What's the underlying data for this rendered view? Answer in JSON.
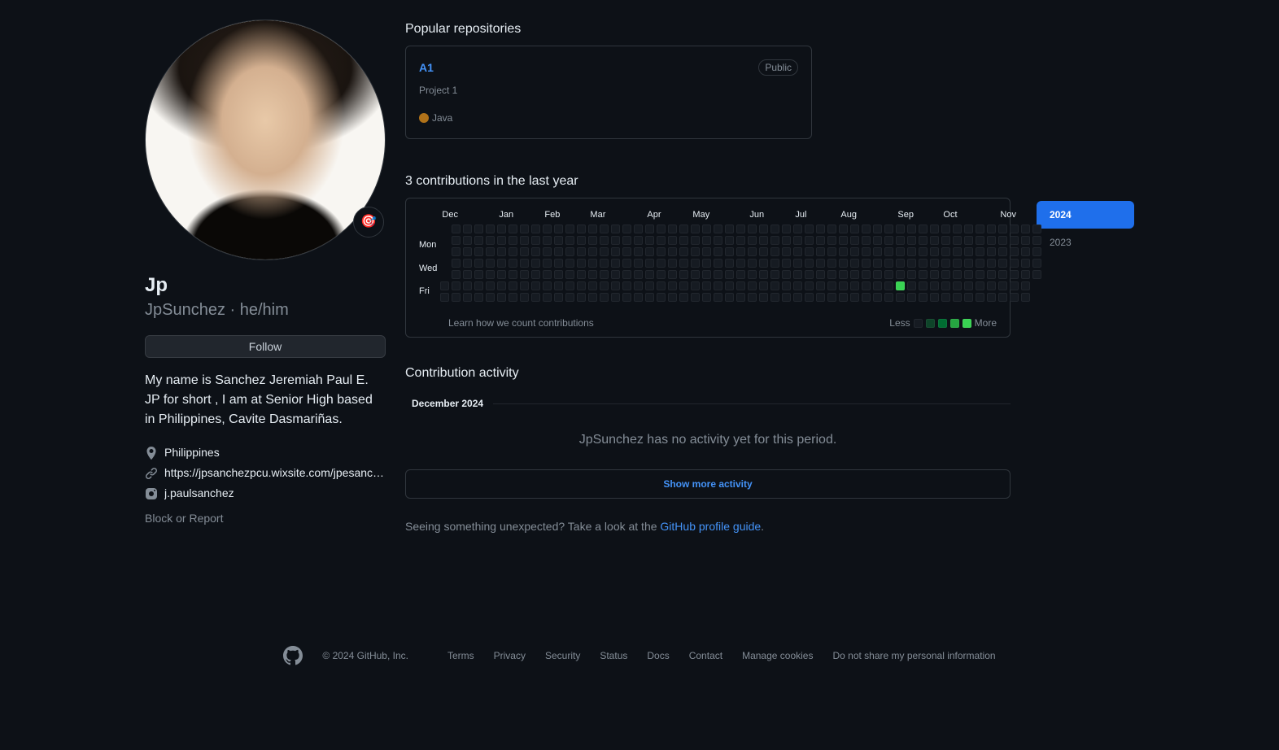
{
  "profile": {
    "name": "Jp",
    "username": "JpSunchez",
    "pronouns": "he/him",
    "username_pronouns": "JpSunchez · he/him",
    "status_emoji": "🎯",
    "follow_label": "Follow",
    "bio": "My name is Sanchez Jeremiah Paul E. JP for short , I am at Senior High based in Philippines, Cavite Dasmariñas.",
    "location": "Philippines",
    "website": "https://jpsanchezpcu.wixsite.com/jpesanchezpcu",
    "instagram": "j.paulsanchez",
    "block_report": "Block or Report"
  },
  "repos": {
    "heading": "Popular repositories",
    "items": [
      {
        "name": "A1",
        "visibility": "Public",
        "description": "Project 1",
        "language": "Java",
        "lang_color": "#b07219"
      }
    ]
  },
  "contributions": {
    "heading": "3 contributions in the last year",
    "months": [
      "Dec",
      "Jan",
      "Feb",
      "Mar",
      "Apr",
      "May",
      "Jun",
      "Jul",
      "Aug",
      "Sep",
      "Oct",
      "Nov"
    ],
    "day_labels": [
      "",
      "Mon",
      "",
      "Wed",
      "",
      "Fri",
      ""
    ],
    "learn_link": "Learn how we count contributions",
    "legend_less": "Less",
    "legend_more": "More"
  },
  "years": [
    "2024",
    "2023"
  ],
  "selected_year": "2024",
  "activity": {
    "heading": "Contribution activity",
    "month": "December 2024",
    "no_activity": "JpSunchez has no activity yet for this period.",
    "show_more": "Show more activity",
    "unexpected_prefix": "Seeing something unexpected? Take a look at the ",
    "unexpected_link": "GitHub profile guide",
    "unexpected_suffix": "."
  },
  "footer": {
    "copyright": "© 2024 GitHub, Inc.",
    "links": [
      "Terms",
      "Privacy",
      "Security",
      "Status",
      "Docs",
      "Contact",
      "Manage cookies",
      "Do not share my personal information"
    ]
  }
}
